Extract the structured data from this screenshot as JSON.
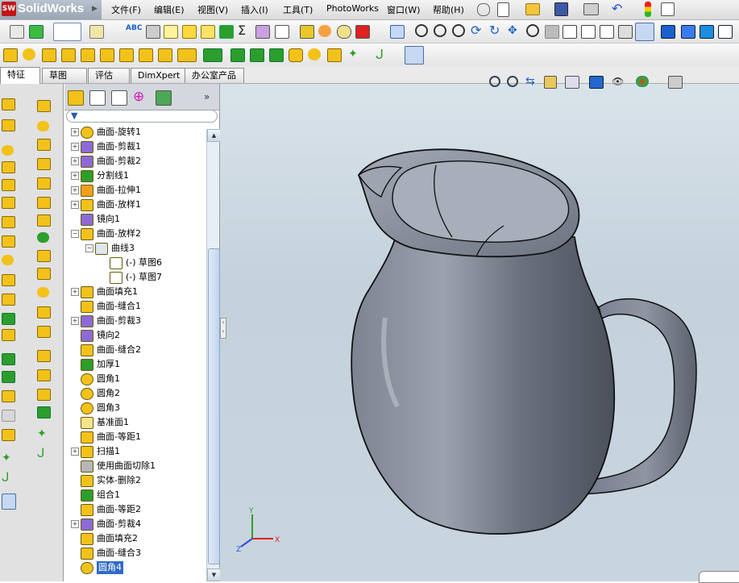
{
  "app": {
    "title": "SolidWorks",
    "logo_badge": "SW",
    "menus": [
      "文件(F)",
      "编辑(E)",
      "视图(V)",
      "插入(I)",
      "工具(T)",
      "PhotoWorks",
      "窗口(W)",
      "帮助(H)"
    ]
  },
  "command_tabs": [
    "特征",
    "草图",
    "评估",
    "DimXpert",
    "办公室产品"
  ],
  "feature_tree": {
    "items": [
      {
        "label": "曲面-旋转1",
        "icon": "revolve-surface-icon",
        "expandable": true
      },
      {
        "label": "曲面-剪裁1",
        "icon": "trim-surface-icon",
        "expandable": true
      },
      {
        "label": "曲面-剪裁2",
        "icon": "trim-surface-icon",
        "expandable": true
      },
      {
        "label": "分割线1",
        "icon": "split-line-icon",
        "expandable": true
      },
      {
        "label": "曲面-拉伸1",
        "icon": "extrude-surface-icon",
        "expandable": true
      },
      {
        "label": "曲面-放样1",
        "icon": "loft-surface-icon",
        "expandable": true
      },
      {
        "label": "镜向1",
        "icon": "mirror-icon",
        "expandable": false
      },
      {
        "label": "曲面-放样2",
        "icon": "loft-surface-icon",
        "expandable": true,
        "expanded": true
      },
      {
        "label": "曲线3",
        "icon": "curve-icon",
        "expandable": true,
        "expanded": true,
        "level": 1
      },
      {
        "label": "(-) 草图6",
        "icon": "sketch-icon",
        "expandable": false,
        "level": 2
      },
      {
        "label": "(-) 草图7",
        "icon": "sketch-icon",
        "expandable": false,
        "level": 2
      },
      {
        "label": "曲面填充1",
        "icon": "fill-surface-icon",
        "expandable": true
      },
      {
        "label": "曲面-缝合1",
        "icon": "knit-surface-icon",
        "expandable": false
      },
      {
        "label": "曲面-剪裁3",
        "icon": "trim-surface-icon",
        "expandable": true
      },
      {
        "label": "镜向2",
        "icon": "mirror-icon",
        "expandable": false
      },
      {
        "label": "曲面-缝合2",
        "icon": "knit-surface-icon",
        "expandable": false
      },
      {
        "label": "加厚1",
        "icon": "thicken-icon",
        "expandable": false
      },
      {
        "label": "圆角1",
        "icon": "fillet-icon",
        "expandable": false
      },
      {
        "label": "圆角2",
        "icon": "fillet-icon",
        "expandable": false
      },
      {
        "label": "圆角3",
        "icon": "fillet-icon",
        "expandable": false
      },
      {
        "label": "基准面1",
        "icon": "plane-icon",
        "expandable": false
      },
      {
        "label": "曲面-等距1",
        "icon": "offset-surface-icon",
        "expandable": false
      },
      {
        "label": "扫描1",
        "icon": "sweep-icon",
        "expandable": true
      },
      {
        "label": "使用曲面切除1",
        "icon": "surface-cut-icon",
        "expandable": false
      },
      {
        "label": "实体-删除2",
        "icon": "delete-body-icon",
        "expandable": false
      },
      {
        "label": "组合1",
        "icon": "combine-icon",
        "expandable": false
      },
      {
        "label": "曲面-等距2",
        "icon": "offset-surface-icon",
        "expandable": false
      },
      {
        "label": "曲面-剪裁4",
        "icon": "trim-surface-icon",
        "expandable": true
      },
      {
        "label": "曲面填充2",
        "icon": "fill-surface-icon",
        "expandable": false
      },
      {
        "label": "曲面-缝合3",
        "icon": "knit-surface-icon",
        "expandable": false
      },
      {
        "label": "圆角4",
        "icon": "fillet-icon",
        "expandable": false,
        "selected": true
      }
    ]
  },
  "triad": {
    "x": "X",
    "y": "Y",
    "z": "Z"
  },
  "colors": {
    "viewport_bg": "#cdd9e2",
    "model_fill": "#6c7280",
    "selection": "#316ac5",
    "tree_icon_yellow": "#f2c21b"
  }
}
